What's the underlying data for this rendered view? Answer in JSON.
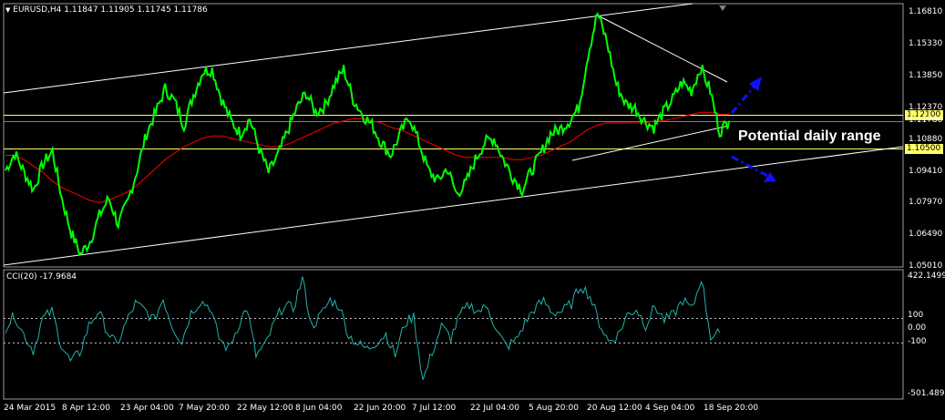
{
  "header": {
    "symbol": "EURUSD,H4",
    "open": "1.11847",
    "high": "1.11905",
    "low": "1.11745",
    "close": "1.11786"
  },
  "indicator": {
    "label": "CCI(20) -17.9684",
    "scale_top": "422.1499",
    "scale_bottom": "-501.489",
    "levels": [
      "100",
      "0.00",
      "-100"
    ]
  },
  "annotation": "Potential daily range",
  "colors": {
    "price": "#00ff00",
    "ma": "#ff0000",
    "cci": "#20b2aa",
    "channel": "#ffffff",
    "level": "#ffff66",
    "arrow": "#1010ff"
  },
  "chart_data": {
    "type": "line",
    "title": "EURUSD,H4",
    "xlabel": "",
    "ylabel": "",
    "ylim": [
      1.0501,
      1.1725
    ],
    "price_ticks": [
      "1.16810",
      "1.15330",
      "1.13850",
      "1.12370",
      "1.11786",
      "1.10880",
      "1.09410",
      "1.07970",
      "1.06490",
      "1.05010"
    ],
    "levels": [
      {
        "label": "1.12100",
        "value": 1.121
      },
      {
        "label": "1.10500",
        "value": 1.105
      }
    ],
    "x_labels": [
      "24 Mar 2015",
      "8 Apr 12:00",
      "23 Apr 04:00",
      "7 May 20:00",
      "22 May 12:00",
      "8 Jun 04:00",
      "22 Jun 20:00",
      "7 Jul 12:00",
      "22 Jul 04:00",
      "5 Aug 20:00",
      "20 Aug 12:00",
      "4 Sep 04:00",
      "18 Sep 20:00"
    ],
    "series": [
      {
        "values": [
          1.095,
          1.103,
          1.094,
          1.086,
          1.098,
          1.104,
          1.082,
          1.066,
          1.056,
          1.062,
          1.074,
          1.082,
          1.07,
          1.08,
          1.095,
          1.112,
          1.122,
          1.133,
          1.127,
          1.116,
          1.13,
          1.141,
          1.142,
          1.128,
          1.118,
          1.112,
          1.119,
          1.105,
          1.094,
          1.102,
          1.113,
          1.124,
          1.131,
          1.122,
          1.125,
          1.135,
          1.142,
          1.128,
          1.121,
          1.116,
          1.108,
          1.102,
          1.112,
          1.12,
          1.108,
          1.095,
          1.09,
          1.096,
          1.084,
          1.089,
          1.1,
          1.108,
          1.11,
          1.1,
          1.092,
          1.086,
          1.095,
          1.103,
          1.112,
          1.114,
          1.118,
          1.124,
          1.149,
          1.168,
          1.155,
          1.135,
          1.126,
          1.124,
          1.118,
          1.115,
          1.122,
          1.128,
          1.136,
          1.132,
          1.143,
          1.132,
          1.113,
          1.118
        ],
        "ma": [
          1.102,
          1.102,
          1.1,
          1.097,
          1.094,
          1.09,
          1.087,
          1.085,
          1.083,
          1.081,
          1.08,
          1.081,
          1.083,
          1.085,
          1.088,
          1.092,
          1.096,
          1.1,
          1.103,
          1.106,
          1.108,
          1.11,
          1.111,
          1.111,
          1.11,
          1.109,
          1.108,
          1.107,
          1.106,
          1.106,
          1.107,
          1.109,
          1.111,
          1.113,
          1.115,
          1.117,
          1.118,
          1.119,
          1.119,
          1.118,
          1.117,
          1.115,
          1.114,
          1.112,
          1.11,
          1.108,
          1.106,
          1.104,
          1.102,
          1.101,
          1.101,
          1.101,
          1.101,
          1.101,
          1.1,
          1.1,
          1.101,
          1.102,
          1.104,
          1.106,
          1.108,
          1.111,
          1.114,
          1.116,
          1.117,
          1.117,
          1.117,
          1.117,
          1.117,
          1.118,
          1.118,
          1.119,
          1.12,
          1.121,
          1.122,
          1.122,
          1.121,
          1.121
        ]
      },
      {
        "name": "CCI(20) -17.9684",
        "values": [
          20,
          120,
          -40,
          -160,
          90,
          150,
          -110,
          -250,
          -180,
          40,
          150,
          -10,
          -120,
          60,
          210,
          160,
          80,
          250,
          30,
          -90,
          140,
          230,
          190,
          -60,
          -150,
          20,
          180,
          -200,
          -120,
          60,
          200,
          170,
          410,
          30,
          120,
          240,
          190,
          -40,
          -110,
          -150,
          -90,
          -30,
          -200,
          50,
          110,
          -400,
          -170,
          30,
          -60,
          120,
          200,
          150,
          190,
          -20,
          -130,
          -80,
          60,
          170,
          230,
          140,
          150,
          210,
          360,
          270,
          60,
          -90,
          -40,
          120,
          170,
          40,
          190,
          80,
          120,
          240,
          160,
          420,
          -50,
          -18
        ]
      }
    ]
  }
}
